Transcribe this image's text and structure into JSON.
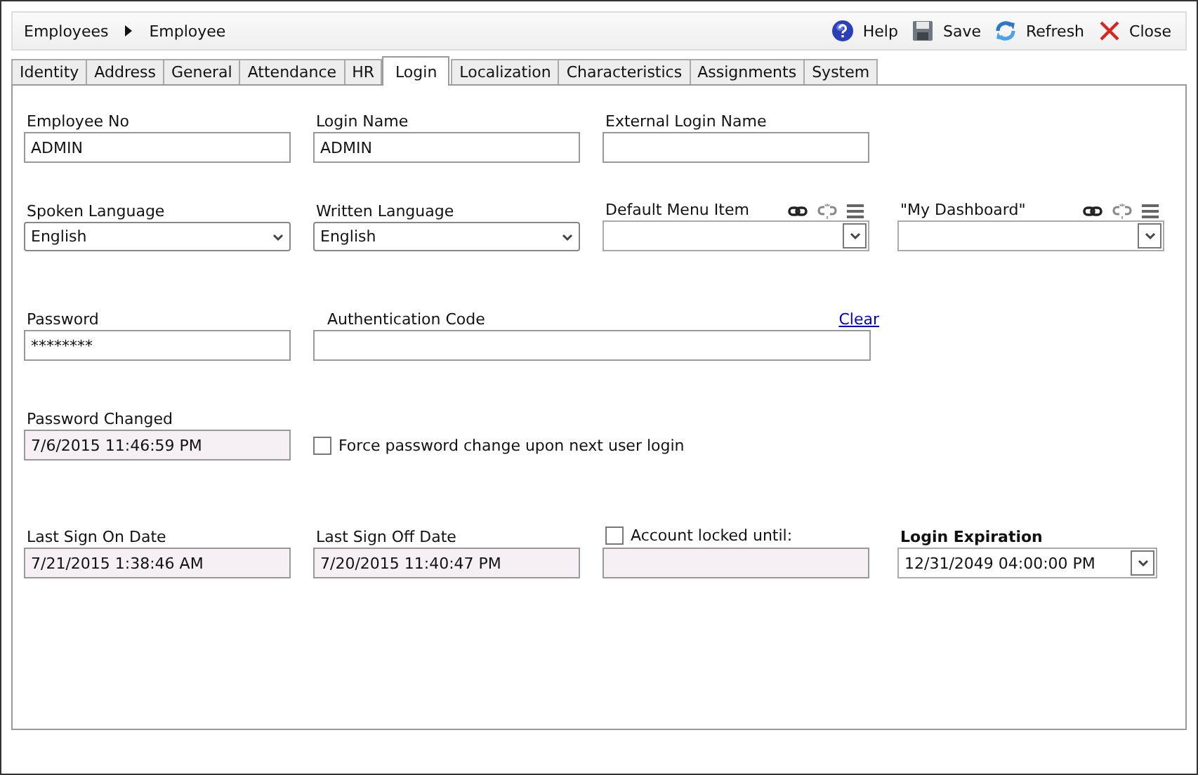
{
  "breadcrumb": [
    "Employees",
    "Employee"
  ],
  "toolbar": [
    {
      "kind": "help",
      "label": "Help"
    },
    {
      "kind": "save",
      "label": "Save"
    },
    {
      "kind": "refresh",
      "label": "Refresh"
    },
    {
      "kind": "close",
      "label": "Close"
    }
  ],
  "tabs": [
    {
      "label": "Identity",
      "selected": false
    },
    {
      "label": "Address",
      "selected": false
    },
    {
      "label": "General",
      "selected": false
    },
    {
      "label": "Attendance",
      "selected": false
    },
    {
      "label": "HR",
      "selected": false
    },
    {
      "label": "Login",
      "selected": true
    },
    {
      "label": "Localization",
      "selected": false
    },
    {
      "label": "Characteristics",
      "selected": false
    },
    {
      "label": "Assignments",
      "selected": false
    },
    {
      "label": "System",
      "selected": false
    }
  ],
  "rows": [
    [
      {
        "kind": "text",
        "label": "Employee No",
        "value": "ADMIN"
      },
      {
        "kind": "text",
        "label": "Login Name",
        "value": "ADMIN"
      },
      {
        "kind": "text",
        "label": "External Login Name"
      }
    ],
    [
      {
        "kind": "select",
        "label": "Spoken Language",
        "value": "English"
      },
      {
        "kind": "select",
        "label": "Written Language",
        "value": "English"
      },
      {
        "kind": "linked-combo",
        "label": "Default Menu Item"
      },
      {
        "kind": "linked-combo",
        "label": "\"My Dashboard\""
      }
    ],
    [
      {
        "kind": "text",
        "label": "Password",
        "value": "********"
      },
      {
        "kind": "wide-text",
        "label": "Authentication Code",
        "link": "Clear"
      }
    ],
    [
      {
        "kind": "readonly",
        "label": "Password Changed",
        "value": "7/6/2015 11:46:59 PM"
      },
      {
        "kind": "check",
        "label": "Force password change upon next user login",
        "checked": false
      }
    ],
    [
      {
        "kind": "readonly",
        "label": "Last Sign On Date",
        "value": "7/21/2015 1:38:46 AM"
      },
      {
        "kind": "readonly",
        "label": "Last Sign Off Date",
        "value": "7/20/2015 11:40:47 PM"
      },
      {
        "kind": "check-field",
        "label": "Account locked until:",
        "checked": false
      },
      {
        "kind": "combo",
        "label": "Login Expiration",
        "emphasis": true,
        "value": "12/31/2049 04:00:00 PM"
      }
    ]
  ]
}
